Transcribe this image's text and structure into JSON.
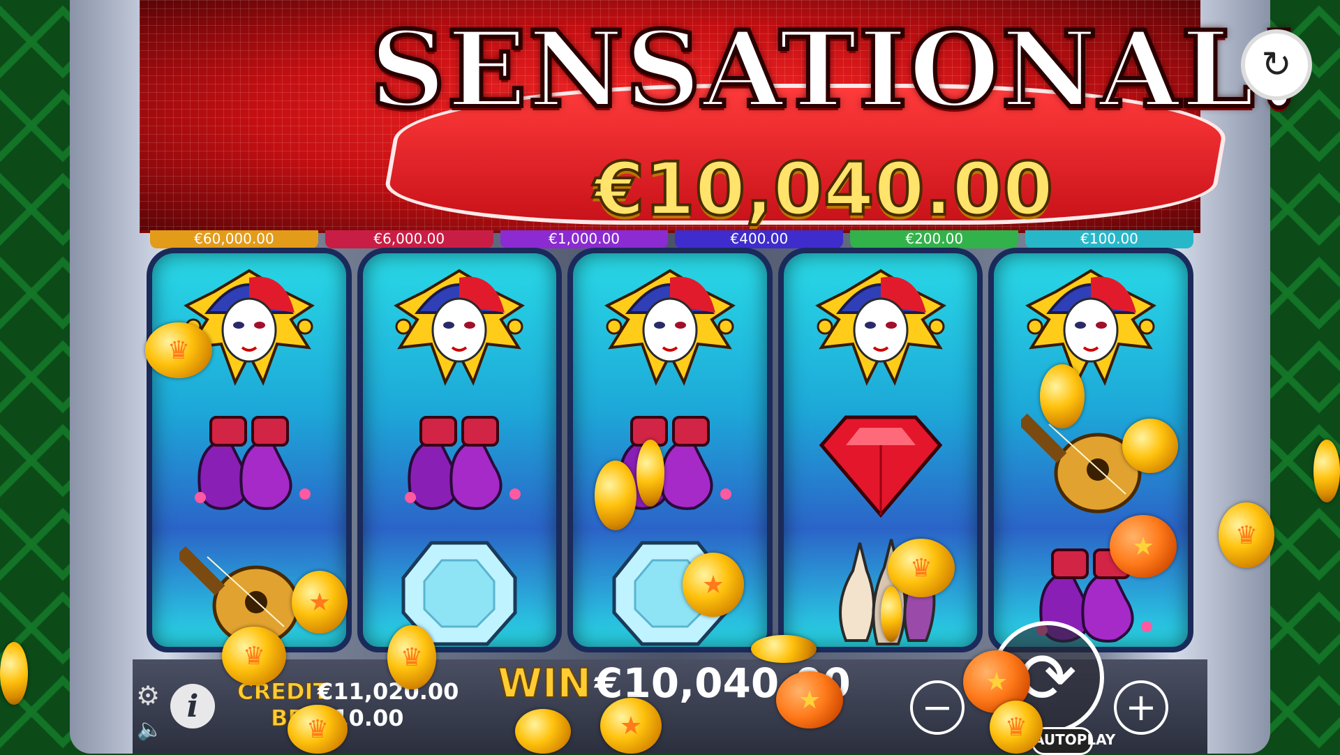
{
  "header": {
    "title": "SENSATIONAL!",
    "amount": "€10,040.00"
  },
  "jackpots": [
    {
      "label": "€60,000.00",
      "color": "#e39b1a"
    },
    {
      "label": "€6,000.00",
      "color": "#c81e45"
    },
    {
      "label": "€1,000.00",
      "color": "#8b2bd1"
    },
    {
      "label": "€400.00",
      "color": "#3f2ccc"
    },
    {
      "label": "€200.00",
      "color": "#32b24a"
    },
    {
      "label": "€100.00",
      "color": "#28b7c9"
    }
  ],
  "reels": [
    {
      "symbols": [
        "jester-mask",
        "jester-shoes",
        "lute"
      ]
    },
    {
      "symbols": [
        "jester-mask",
        "jester-shoes",
        "diamond-blue"
      ]
    },
    {
      "symbols": [
        "jester-mask",
        "jester-shoes",
        "diamond-blue"
      ]
    },
    {
      "symbols": [
        "jester-mask",
        "ruby",
        "juggling-pins"
      ]
    },
    {
      "symbols": [
        "jester-mask",
        "lute",
        "jester-shoes"
      ]
    }
  ],
  "status": {
    "credit_label": "CREDIT",
    "credit_value": "€11,020.00",
    "bet_label": "BET",
    "bet_value": "€10.00",
    "win_label": "WIN",
    "win_value": "€10,040.00"
  },
  "controls": {
    "autoplay_label": "AUTOPLAY",
    "info_icon": "info-icon",
    "settings_icon": "gear-icon",
    "sound_icon": "speaker-icon",
    "spin_icon": "spin-arrows-icon",
    "replay_icon": "replay-icon",
    "minus_icon": "minus-icon",
    "plus_icon": "plus-icon"
  },
  "colors": {
    "accent_gold": "#ffcc33",
    "banner_red": "#c40f12",
    "background_green": "#0c4a18"
  }
}
